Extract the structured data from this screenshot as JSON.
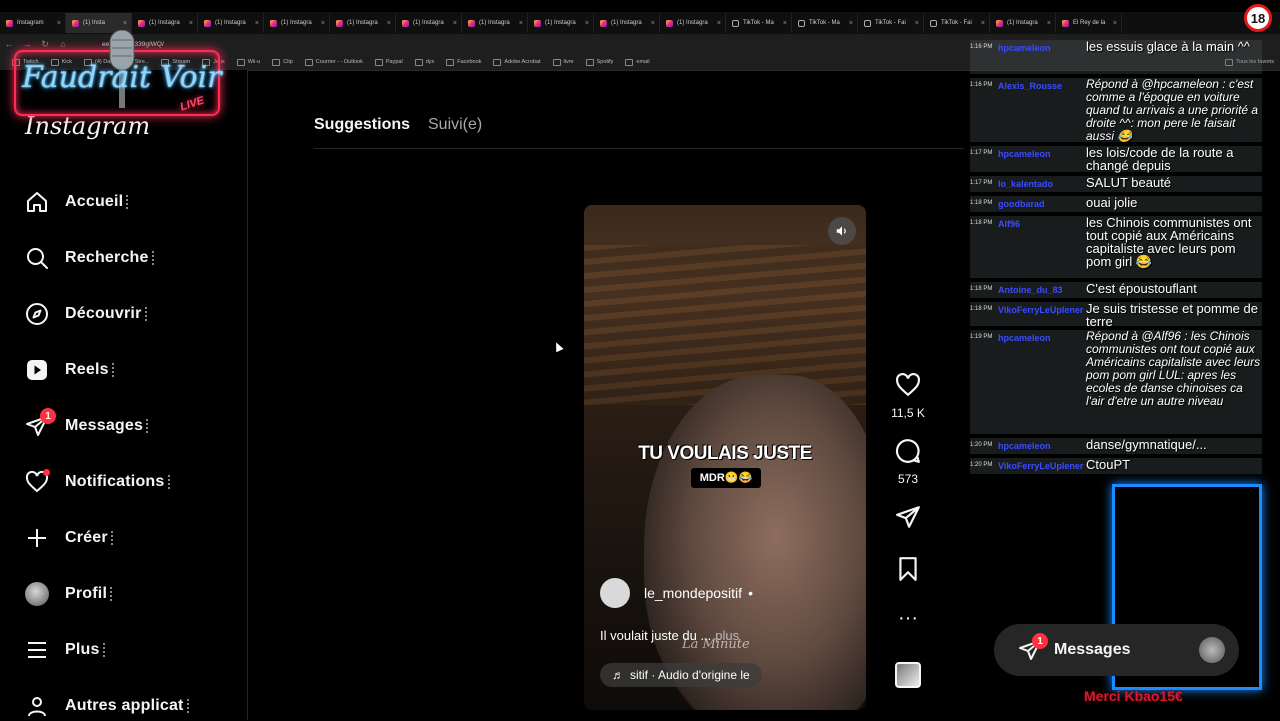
{
  "browser": {
    "tabs": [
      {
        "title": "Instagram",
        "type": "ig"
      },
      {
        "title": "(1) Insta",
        "type": "ig",
        "active": true
      },
      {
        "title": "(1) Instagra",
        "type": "ig"
      },
      {
        "title": "(1) Instagra",
        "type": "ig"
      },
      {
        "title": "(1) Instagra",
        "type": "ig"
      },
      {
        "title": "(1) Instagra",
        "type": "ig"
      },
      {
        "title": "(1) Instagra",
        "type": "ig"
      },
      {
        "title": "(1) Instagra",
        "type": "ig"
      },
      {
        "title": "(1) Instagra",
        "type": "ig"
      },
      {
        "title": "(1) Instagra",
        "type": "ig"
      },
      {
        "title": "(1) Instagra",
        "type": "ig"
      },
      {
        "title": "TikTok - Ma",
        "type": "tt"
      },
      {
        "title": "TikTok - Ma",
        "type": "tt"
      },
      {
        "title": "TikTok - Fai",
        "type": "tt"
      },
      {
        "title": "TikTok - Fai",
        "type": "tt"
      },
      {
        "title": "(1) Instagra",
        "type": "ig"
      },
      {
        "title": "El Rey de la",
        "type": "ig"
      }
    ],
    "url": "eels/DSUO339gIWQ/",
    "bookmarks": [
      "Twitch",
      "Kick",
      "(4) Dashboard / Stre...",
      "Stream",
      "Jeux",
      "Wii-u",
      "Clip",
      "Courrier - - Outlook",
      "Paypal",
      "dys",
      "Facebook",
      "Adobe Acrobat",
      "livre",
      "Spotify",
      "email"
    ],
    "bookmarks_right": "Tous les favoris"
  },
  "overlay": {
    "title": "Faudrait Voir",
    "live": "LIVE",
    "age": "18"
  },
  "sidebar": {
    "logo": "Instagram",
    "items": [
      {
        "label": "Accueil",
        "icon": "home-icon"
      },
      {
        "label": "Recherche",
        "icon": "search-icon"
      },
      {
        "label": "Découvrir",
        "icon": "compass-icon"
      },
      {
        "label": "Reels",
        "icon": "reels-icon"
      },
      {
        "label": "Messages",
        "icon": "messenger-icon",
        "badge": "1"
      },
      {
        "label": "Notifications",
        "icon": "heart-icon"
      },
      {
        "label": "Créer",
        "icon": "plus-icon"
      },
      {
        "label": "Profil",
        "icon": "avatar"
      },
      {
        "label": "Plus",
        "icon": "menu-icon"
      },
      {
        "label": "Autres applicat",
        "icon": "apps-icon"
      }
    ]
  },
  "feed": {
    "tab_suggestions": "Suggestions",
    "tab_following": "Suivi(e)"
  },
  "reel": {
    "caption_big": "TU VOULAIS JUSTE",
    "caption_small": "MDR😬😂",
    "username": "le_mondepositif",
    "username_suffix": "•",
    "description": "Il voulait juste du ...",
    "more": "plus",
    "watermark": "La Minute",
    "audio": "sitif · Audio d'origine  le",
    "likes": "11,5 K",
    "comments": "573"
  },
  "chat": {
    "messages": [
      {
        "time": "1:16 PM",
        "user": "hpcameleon",
        "text": "les essuis glace à la main ^^",
        "italic": false
      },
      {
        "time": "1:16 PM",
        "user": "Alexis_Rousse",
        "text": "Répond à @hpcameleon : c'est comme a l'époque en voiture quand tu arrivais a une priorité a droite ^^: mon pere le faisait aussi 😂",
        "italic": true
      },
      {
        "time": "1:17 PM",
        "user": "hpcameleon",
        "text": "les lois/code de la route a changé depuis",
        "italic": false
      },
      {
        "time": "1:17 PM",
        "user": "lo_kalentado",
        "text": "SALUT beauté",
        "italic": false
      },
      {
        "time": "1:18 PM",
        "user": "goodbarad",
        "text": "ouai jolie",
        "italic": false
      },
      {
        "time": "1:18 PM",
        "user": "Alf96",
        "text": "les Chinois communistes ont tout copié aux Américains capitaliste avec leurs pom pom girl 😂",
        "italic": false
      },
      {
        "time": "1:18 PM",
        "user": "Antoine_du_83",
        "text": "C'est époustouflant",
        "italic": false
      },
      {
        "time": "1:18 PM",
        "user": "VikoFerryLeUplener",
        "text": "Je suis tristesse et pomme de terre",
        "italic": false
      },
      {
        "time": "1:19 PM",
        "user": "hpcameleon",
        "text": "Répond à @Alf96 : les Chinois communistes ont tout copié aux Américains capitaliste avec leurs pom pom girl LUL: apres les ecoles de danse chinoises ca l'air d'etre un autre niveau",
        "italic": true
      },
      {
        "time": "1:20 PM",
        "user": "hpcameleon",
        "text": "danse/gymnatique/...",
        "italic": false
      },
      {
        "time": "1:20 PM",
        "user": "VikoFerryLeUplener",
        "text": "CtouPT",
        "italic": false
      }
    ]
  },
  "messages_pill": {
    "label": "Messages",
    "badge": "1"
  },
  "donation": "Merci Kbao15€"
}
